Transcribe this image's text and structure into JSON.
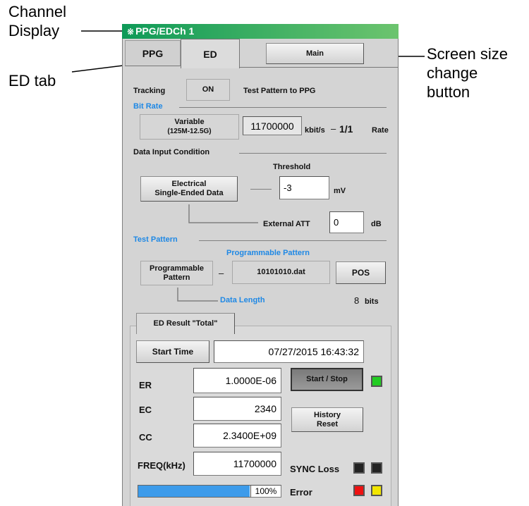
{
  "callouts": {
    "channel_display_1": "Channel",
    "channel_display_2": "Display",
    "ed_tab": "ED tab",
    "screen_size_1": "Screen size",
    "screen_size_2": "change",
    "screen_size_3": "button"
  },
  "window": {
    "icon": "※",
    "title": "PPG/EDCh 1"
  },
  "tabs": {
    "ppg": "PPG",
    "ed": "ED",
    "main_button": "Main"
  },
  "tracking": {
    "label": "Tracking",
    "button": "ON",
    "text": "Test Pattern to PPG"
  },
  "bit_rate": {
    "section": "Bit Rate",
    "mode_line1": "Variable",
    "mode_line2": "(125M-12.5G)",
    "value": "11700000",
    "unit": "kbit/s",
    "divider": "–",
    "ratio": "1/1",
    "rate_label": "Rate"
  },
  "data_input": {
    "section": "Data Input Condition",
    "threshold_label": "Threshold",
    "type_line1": "Electrical",
    "type_line2": "Single-Ended Data",
    "threshold_value": "-3",
    "threshold_unit": "mV",
    "att_label": "External ATT",
    "att_value": "0",
    "att_unit": "dB"
  },
  "test_pattern": {
    "section": "Test Pattern",
    "prog_label": "Programmable Pattern",
    "type_line1": "Programmable",
    "type_line2": "Pattern",
    "dash": "–",
    "file": "10101010.dat",
    "pos_button": "POS",
    "length_label": "Data Length",
    "length_value": "8",
    "length_unit": "bits"
  },
  "result": {
    "tab": "ED Result \"Total\"",
    "start_time_button": "Start Time",
    "start_time_value": "07/27/2015 16:43:32",
    "rows": [
      {
        "label": "ER",
        "value": "1.0000E-06"
      },
      {
        "label": "EC",
        "value": "2340"
      },
      {
        "label": "CC",
        "value": "2.3400E+09"
      },
      {
        "label": "FREQ(kHz)",
        "value": "11700000"
      }
    ],
    "start_stop_button": "Start / Stop",
    "history_line1": "History",
    "history_line2": "Reset",
    "sync_loss_label": "SYNC Loss",
    "error_label": "Error",
    "progress_percent": 100,
    "progress_text": "100%"
  },
  "colors": {
    "accent_blue": "#1e88e5",
    "led_green": "#22cc22",
    "led_red": "#ee1111",
    "led_yellow": "#f2e600",
    "led_off": "#222222",
    "titlebar_start": "#0e9a58",
    "titlebar_end": "#6cc46e"
  }
}
